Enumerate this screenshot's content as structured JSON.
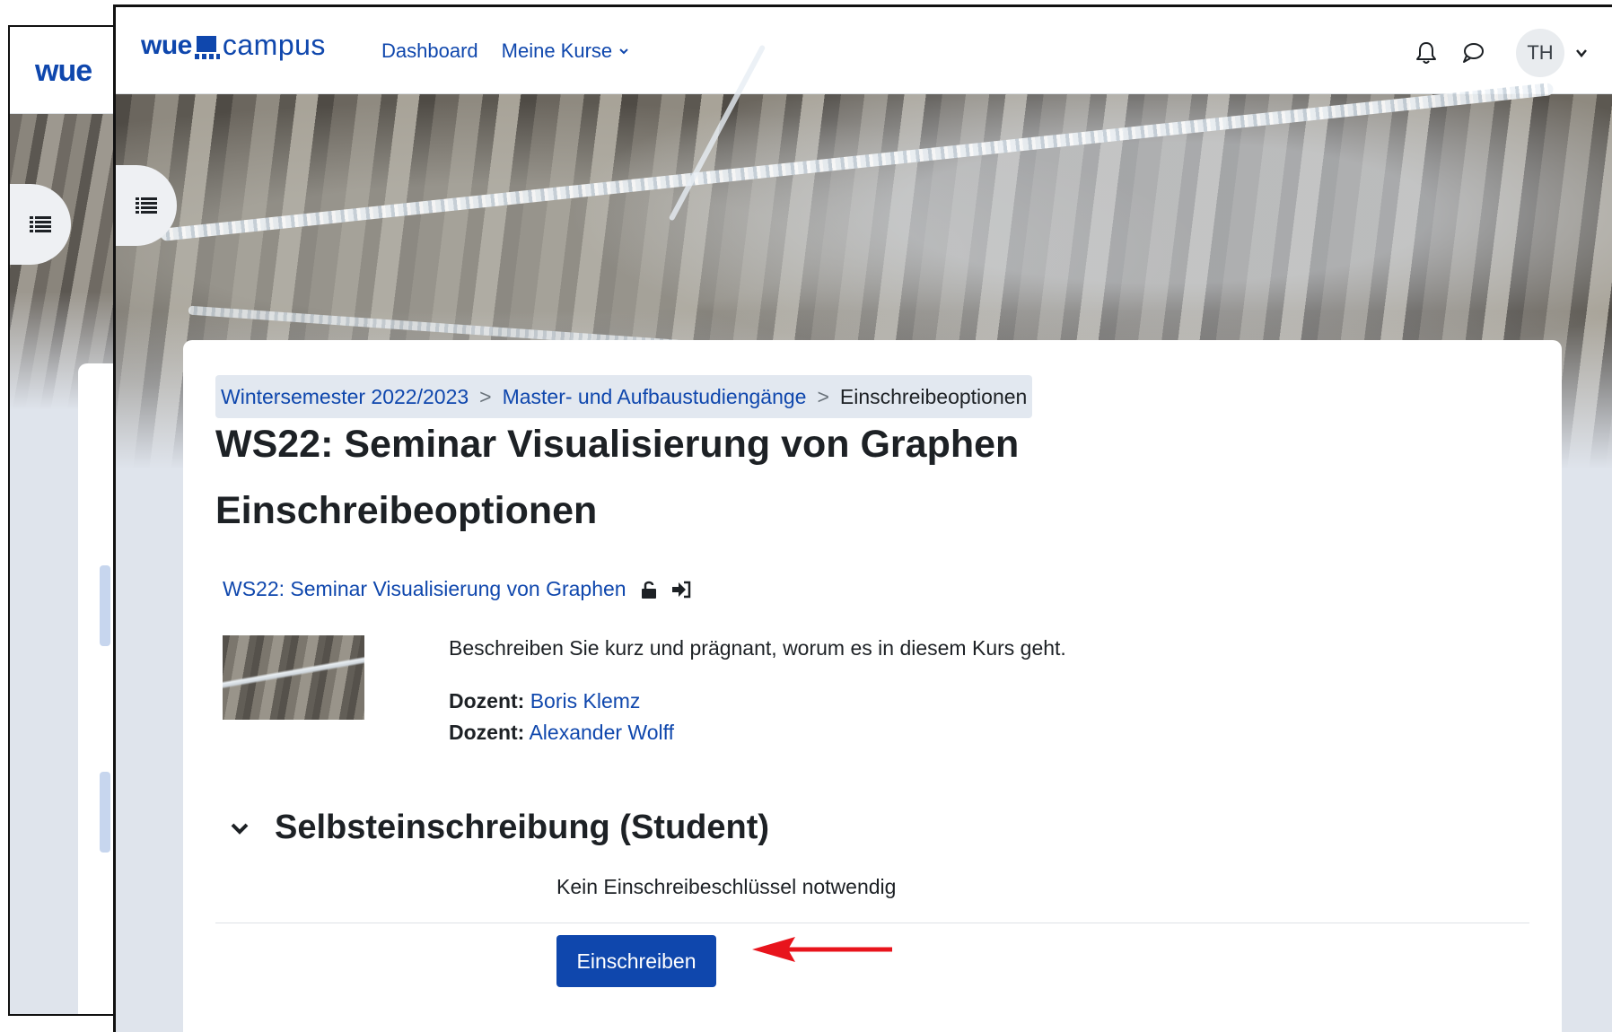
{
  "back_window": {
    "logo_text": "wue"
  },
  "navbar": {
    "brand_left": "wue",
    "brand_right": "campus",
    "dashboard_label": "Dashboard",
    "my_courses_label": "Meine Kurse",
    "avatar_initials": "TH"
  },
  "breadcrumb": {
    "items": [
      "Wintersemester 2022/2023",
      "Master- und Aufbaustudiengänge",
      "Einschreibeoptionen"
    ],
    "separator": ">"
  },
  "page": {
    "title": "WS22: Seminar Visualisierung von Graphen",
    "subtitle": "Einschreibeoptionen"
  },
  "course": {
    "link_text": "WS22: Seminar Visualisierung von Graphen",
    "description": "Beschreiben Sie kurz und prägnant, worum es in diesem Kurs geht.",
    "teachers": [
      {
        "label": "Dozent:",
        "name": "Boris Klemz"
      },
      {
        "label": "Dozent:",
        "name": "Alexander Wolff"
      }
    ]
  },
  "enrol_section": {
    "heading": "Selbsteinschreibung (Student)",
    "no_key_text": "Kein Einschreibeschlüssel notwendig",
    "button_label": "Einschreiben"
  },
  "colors": {
    "brand_blue": "#0f47ad",
    "annotation_arrow": "#e8141c",
    "page_background": "#dfe4ec"
  },
  "icons": [
    "hamburger-list-icon",
    "bell-icon",
    "chat-bubble-icon",
    "chevron-down-icon",
    "unlock-icon",
    "sign-in-icon"
  ]
}
